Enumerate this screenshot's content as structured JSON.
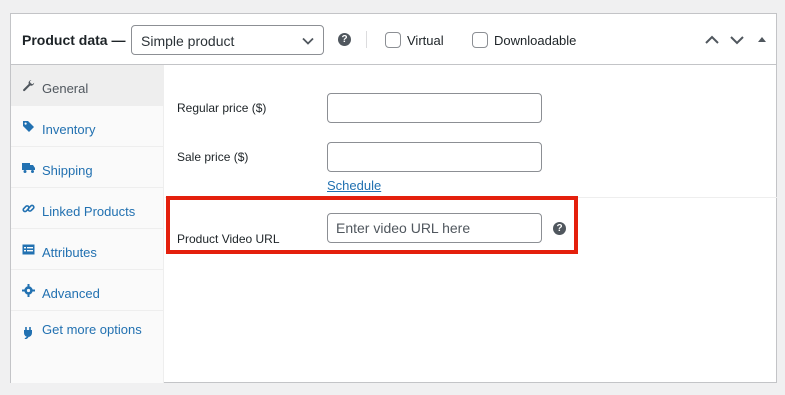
{
  "header": {
    "title": "Product data —",
    "product_type": "Simple product",
    "help": "?",
    "virtual_label": "Virtual",
    "downloadable_label": "Downloadable"
  },
  "sidebar": {
    "items": [
      {
        "label": "General",
        "icon": "wrench-icon",
        "active": true
      },
      {
        "label": "Inventory",
        "icon": "tag-icon"
      },
      {
        "label": "Shipping",
        "icon": "truck-icon"
      },
      {
        "label": "Linked Products",
        "icon": "link-icon"
      },
      {
        "label": "Attributes",
        "icon": "table-icon"
      },
      {
        "label": "Advanced",
        "icon": "gear-icon"
      },
      {
        "label": "Get more options",
        "icon": "plugin-icon"
      }
    ]
  },
  "main": {
    "regular_price_label": "Regular price ($)",
    "regular_price_value": "",
    "sale_price_label": "Sale price ($)",
    "sale_price_value": "",
    "schedule_link": "Schedule",
    "video_url_label": "Product Video URL",
    "video_url_placeholder": "Enter video URL here",
    "video_url_value": "",
    "help": "?"
  },
  "colors": {
    "link": "#2271b1",
    "highlight": "#e4200d",
    "border": "#c3c4c7"
  }
}
